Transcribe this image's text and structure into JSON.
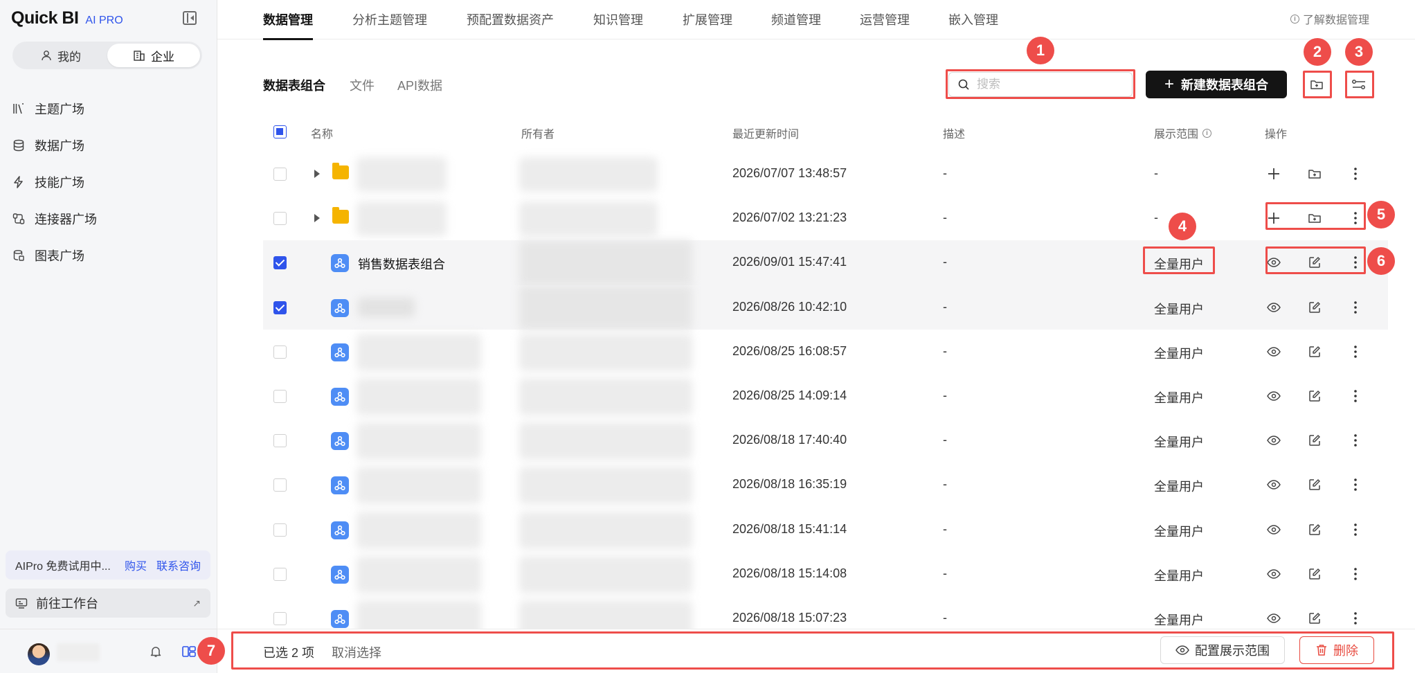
{
  "brand": {
    "name": "Quick BI",
    "tag": "AI PRO"
  },
  "sidebar": {
    "segments": [
      {
        "label": "我的",
        "active": false
      },
      {
        "label": "企业",
        "active": true
      }
    ],
    "items": [
      {
        "label": "主题广场",
        "icon": "books-icon"
      },
      {
        "label": "数据广场",
        "icon": "database-icon"
      },
      {
        "label": "技能广场",
        "icon": "lightning-icon"
      },
      {
        "label": "连接器广场",
        "icon": "connector-icon"
      },
      {
        "label": "图表广场",
        "icon": "chart-db-icon"
      }
    ],
    "trial_text": "AIPro 免费试用中...",
    "buy_label": "购买",
    "consult_label": "联系咨询",
    "workspace_label": "前往工作台",
    "workspace_arrow": "↗"
  },
  "top_tabs": [
    {
      "label": "数据管理",
      "active": true
    },
    {
      "label": "分析主题管理",
      "active": false
    },
    {
      "label": "预配置数据资产",
      "active": false
    },
    {
      "label": "知识管理",
      "active": false
    },
    {
      "label": "扩展管理",
      "active": false
    },
    {
      "label": "频道管理",
      "active": false
    },
    {
      "label": "运营管理",
      "active": false
    },
    {
      "label": "嵌入管理",
      "active": false
    }
  ],
  "help_link": "了解数据管理",
  "sub_tabs": [
    {
      "label": "数据表组合",
      "active": true
    },
    {
      "label": "文件",
      "active": false
    },
    {
      "label": "API数据",
      "active": false
    }
  ],
  "search": {
    "placeholder": "搜索"
  },
  "new_button": {
    "icon": "+",
    "label": "新建数据表组合"
  },
  "table": {
    "headers": {
      "name": "名称",
      "owner": "所有者",
      "updated": "最近更新时间",
      "desc": "描述",
      "scope": "展示范围",
      "actions": "操作"
    },
    "rows": [
      {
        "type": "folder",
        "checked": false,
        "name": "",
        "updated": "2026/07/07 13:48:57",
        "desc": "-",
        "scope": "-"
      },
      {
        "type": "folder",
        "checked": false,
        "name": "",
        "updated": "2026/07/02 13:21:23",
        "desc": "-",
        "scope": "-"
      },
      {
        "type": "combo",
        "checked": true,
        "name": "销售数据表组合",
        "updated": "2026/09/01 15:47:41",
        "desc": "-",
        "scope": "全量用户"
      },
      {
        "type": "combo",
        "checked": true,
        "name": "",
        "updated": "2026/08/26 10:42:10",
        "desc": "-",
        "scope": "全量用户"
      },
      {
        "type": "combo",
        "checked": false,
        "name": "",
        "updated": "2026/08/25 16:08:57",
        "desc": "-",
        "scope": "全量用户"
      },
      {
        "type": "combo",
        "checked": false,
        "name": "",
        "updated": "2026/08/25 14:09:14",
        "desc": "-",
        "scope": "全量用户"
      },
      {
        "type": "combo",
        "checked": false,
        "name": "",
        "updated": "2026/08/18 17:40:40",
        "desc": "-",
        "scope": "全量用户"
      },
      {
        "type": "combo",
        "checked": false,
        "name": "",
        "updated": "2026/08/18 16:35:19",
        "desc": "-",
        "scope": "全量用户"
      },
      {
        "type": "combo",
        "checked": false,
        "name": "",
        "updated": "2026/08/18 15:41:14",
        "desc": "-",
        "scope": "全量用户"
      },
      {
        "type": "combo",
        "checked": false,
        "name": "",
        "updated": "2026/08/18 15:14:08",
        "desc": "-",
        "scope": "全量用户"
      },
      {
        "type": "combo",
        "checked": false,
        "name": "",
        "updated": "2026/08/18 15:07:23",
        "desc": "-",
        "scope": "全量用户"
      }
    ]
  },
  "footer": {
    "selected_text": "已选 2 项",
    "cancel_label": "取消选择",
    "config_label": "配置展示范围",
    "delete_label": "删除"
  },
  "annotations": [
    "1",
    "2",
    "3",
    "4",
    "5",
    "6",
    "7"
  ],
  "colors": {
    "accent": "#2f54eb",
    "annotation": "#ee4d4a",
    "danger": "#e84a3f",
    "primary_button": "#141414"
  }
}
